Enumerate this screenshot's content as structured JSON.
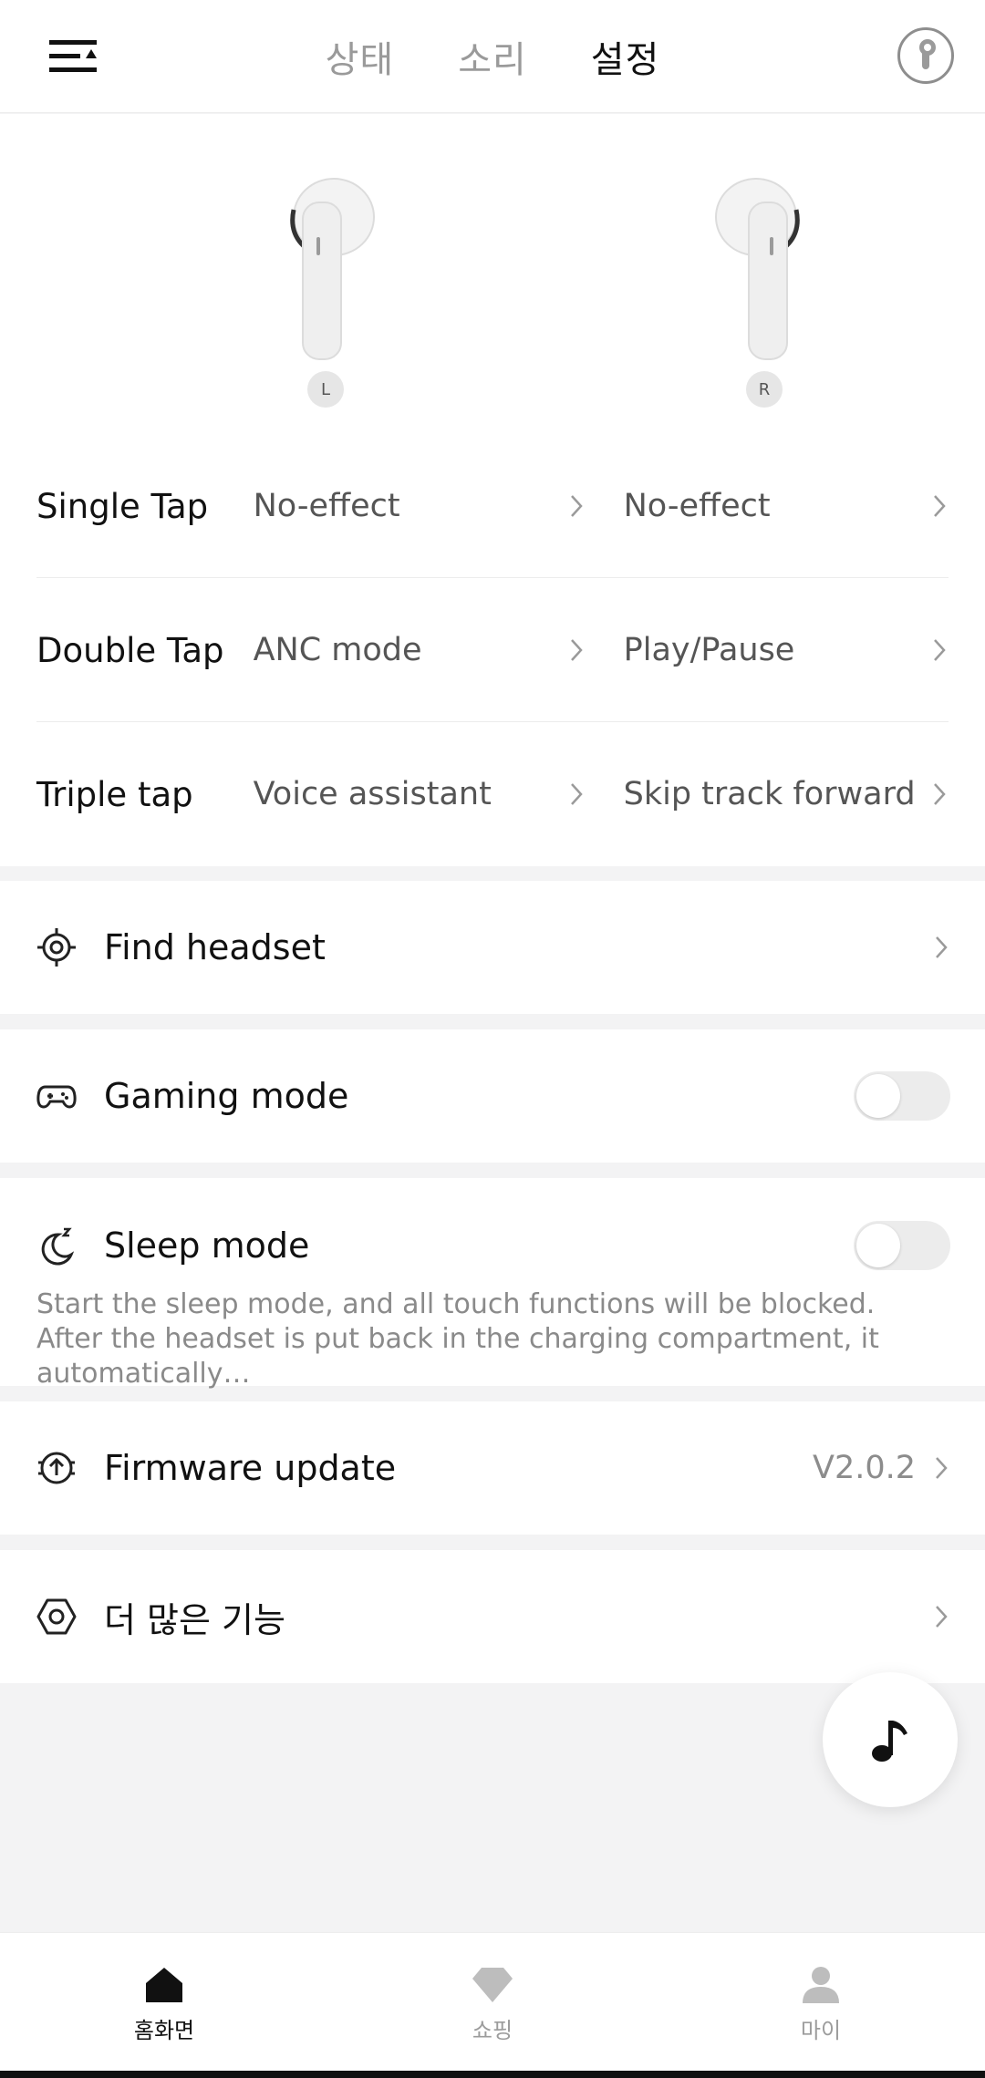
{
  "header": {
    "tabs": [
      {
        "label": "상태"
      },
      {
        "label": "소리"
      },
      {
        "label": "설정"
      }
    ]
  },
  "earbuds": {
    "left_label": "L",
    "right_label": "R"
  },
  "taps": [
    {
      "name": "Single Tap",
      "left": "No-effect",
      "right": "No-effect"
    },
    {
      "name": "Double Tap",
      "left": "ANC mode",
      "right": "Play/Pause"
    },
    {
      "name": "Triple tap",
      "left": "Voice assistant",
      "right": "Skip track forward"
    }
  ],
  "settings": {
    "find_headset": {
      "label": "Find headset"
    },
    "gaming_mode": {
      "label": "Gaming mode",
      "enabled": false
    },
    "sleep_mode": {
      "label": "Sleep mode",
      "enabled": false,
      "description": "Start the sleep mode, and all touch functions will be blocked. After the headset is put back in the charging compartment, it automatically…"
    },
    "firmware": {
      "label": "Firmware update",
      "version": "V2.0.2"
    },
    "more": {
      "label": "더 많은 기능"
    }
  },
  "bottom_nav": [
    {
      "label": "홈화면",
      "icon": "home-icon",
      "active": true
    },
    {
      "label": "쇼핑",
      "icon": "shopping-icon",
      "active": false
    },
    {
      "label": "마이",
      "icon": "profile-icon",
      "active": false
    }
  ],
  "colors": {
    "background": "#f3f3f4",
    "card": "#ffffff",
    "text_primary": "#111111",
    "text_secondary": "#8c8c8c",
    "toggle_off": "#ececec"
  }
}
